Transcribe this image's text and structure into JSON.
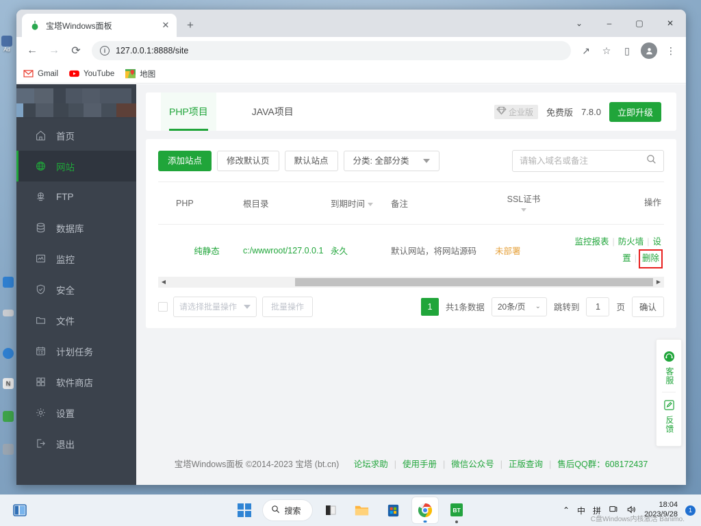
{
  "browser": {
    "tab_title": "宝塔Windows面板",
    "tab_close": "✕",
    "new_tab": "+",
    "window_controls": {
      "more": "⌄",
      "minimize": "–",
      "maximize": "▢",
      "close": "✕"
    },
    "nav": {
      "back": "←",
      "forward": "→",
      "reload": "⟳"
    },
    "url": "127.0.0.1:8888/site",
    "omnibox_info": "i",
    "toolbar_icons": {
      "share": "↗",
      "bookmark": "☆",
      "sidepanel": "▯",
      "menu": "⋮"
    },
    "bookmarks": [
      {
        "label": "Gmail",
        "icon": "gmail-icon"
      },
      {
        "label": "YouTube",
        "icon": "youtube-icon"
      },
      {
        "label": "地图",
        "icon": "maps-icon"
      }
    ]
  },
  "sidebar": {
    "items": [
      {
        "label": "首页",
        "icon": "home-icon",
        "active": false
      },
      {
        "label": "网站",
        "icon": "globe-icon",
        "active": true
      },
      {
        "label": "FTP",
        "icon": "ftp-icon",
        "active": false
      },
      {
        "label": "数据库",
        "icon": "database-icon",
        "active": false
      },
      {
        "label": "监控",
        "icon": "monitor-icon",
        "active": false
      },
      {
        "label": "安全",
        "icon": "shield-icon",
        "active": false
      },
      {
        "label": "文件",
        "icon": "folder-icon",
        "active": false
      },
      {
        "label": "计划任务",
        "icon": "calendar-icon",
        "active": false
      },
      {
        "label": "软件商店",
        "icon": "apps-icon",
        "active": false
      },
      {
        "label": "设置",
        "icon": "gear-icon",
        "active": false
      },
      {
        "label": "退出",
        "icon": "logout-icon",
        "active": false
      }
    ]
  },
  "tabs": {
    "php": "PHP项目",
    "java": "JAVA项目"
  },
  "version": {
    "enterprise_badge": "企业版",
    "edition": "免费版",
    "number": "7.8.0",
    "upgrade": "立即升级"
  },
  "toolbar": {
    "add_site": "添加站点",
    "modify_default_page": "修改默认页",
    "default_site": "默认站点",
    "category": "分类: 全部分类"
  },
  "search": {
    "placeholder": "请输入域名或备注",
    "value": ""
  },
  "table": {
    "headers": [
      "PHP",
      "根目录",
      "到期时间",
      "备注",
      "SSL证书",
      "操作"
    ],
    "rows": [
      {
        "php": "纯静态",
        "root": "c:/wwwroot/127.0.0.1",
        "expire": "永久",
        "remark": "默认网站，将网站源码",
        "ssl": "未部署",
        "ops": [
          "监控报表",
          "防火墙",
          "设置",
          "删除"
        ]
      }
    ]
  },
  "list_footer": {
    "batch_select_placeholder": "请选择批量操作",
    "batch_button": "批量操作"
  },
  "pagination": {
    "current_page": "1",
    "total_text": "共1条数据",
    "page_size": "20条/页",
    "jump_label": "跳转到",
    "jump_value": "1",
    "page_unit": "页",
    "confirm": "确认"
  },
  "page_footer": {
    "copyright": "宝塔Windows面板 ©2014-2023 宝塔 (bt.cn)",
    "links": [
      "论坛求助",
      "使用手册",
      "微信公众号",
      "正版查询"
    ],
    "qq_text": "售后QQ群：608172437"
  },
  "float_panel": {
    "service": "客服",
    "feedback": "反馈"
  },
  "taskbar": {
    "search_text": "搜索",
    "ime_lang": "中",
    "ime_mode": "拼",
    "time": "18:04",
    "date": "2023/9/28",
    "watermark": "C盘Windows内核激活 Banimo.",
    "notif_count": "1"
  },
  "desktop": {
    "icon_label": "Ad"
  },
  "colors": {
    "accent_green": "#20a53a",
    "sidebar_bg": "#3b424c",
    "highlight_red": "#e8211f",
    "warn_orange": "#e6a23c"
  }
}
